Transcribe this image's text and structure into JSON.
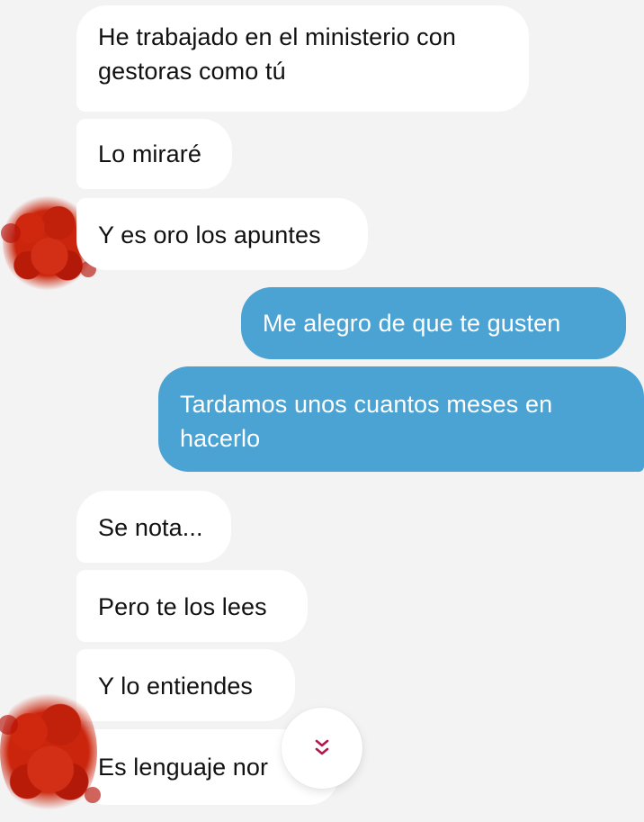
{
  "messages": [
    {
      "from": "contact",
      "text": "He trabajado en el ministerio con\ngestoras como tú"
    },
    {
      "from": "contact",
      "text": "Lo miraré"
    },
    {
      "from": "contact",
      "text": "Y es oro los apuntes"
    },
    {
      "from": "me",
      "text": "Me alegro de que te gusten"
    },
    {
      "from": "me",
      "text": "Tardamos unos cuantos meses en\nhacerlo"
    },
    {
      "from": "contact",
      "text": "Se nota..."
    },
    {
      "from": "contact",
      "text": "Pero te los lees"
    },
    {
      "from": "contact",
      "text": "Y lo entiendes"
    },
    {
      "from": "contact",
      "text": "Es lenguaje nor"
    }
  ],
  "colors": {
    "background": "#f3f3f4",
    "incoming_bubble": "#ffffff",
    "outgoing_bubble": "#4aa3d3",
    "scroll_icon": "#b2184c",
    "avatar_redaction": "#c42b14"
  },
  "icons": {
    "scroll_down": "chevron-double-down-icon"
  }
}
